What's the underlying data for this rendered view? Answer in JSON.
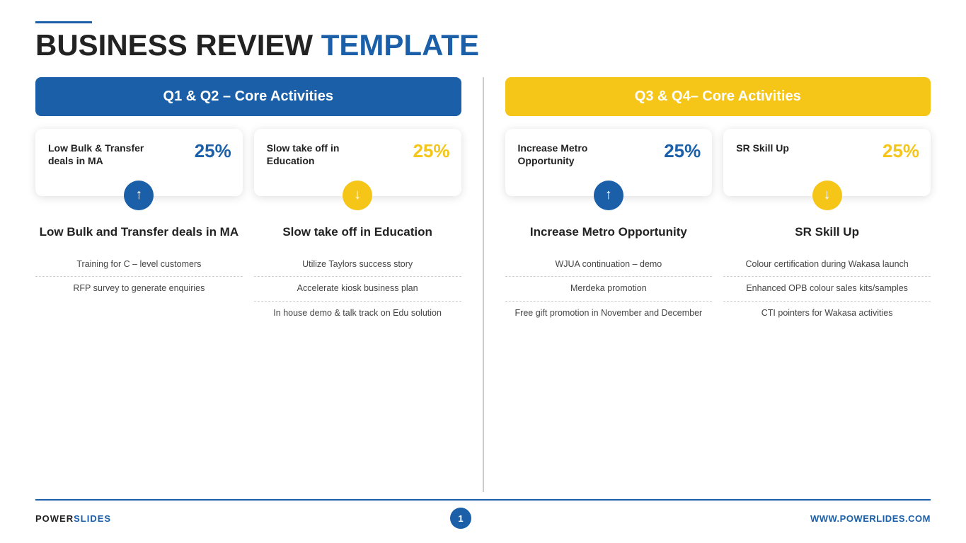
{
  "header": {
    "line": true,
    "title_black": "BUSINESS REVIEW",
    "title_blue": "TEMPLATE"
  },
  "left_section": {
    "header_label": "Q1 & Q2 – Core Activities",
    "cards": [
      {
        "title": "Low Bulk & Transfer deals in MA",
        "percent": "25%",
        "percent_color": "blue",
        "icon": "up",
        "icon_color": "blue"
      },
      {
        "title": "Slow take off in Education",
        "percent": "25%",
        "percent_color": "yellow",
        "icon": "down",
        "icon_color": "yellow"
      }
    ],
    "columns": [
      {
        "title": "Low Bulk and Transfer deals in MA",
        "items": [
          "Training for C – level customers",
          "RFP survey to generate enquiries"
        ]
      },
      {
        "title": "Slow take off in Education",
        "items": [
          "Utilize Taylors success story",
          "Accelerate kiosk business plan",
          "In house demo & talk track on Edu solution"
        ]
      }
    ]
  },
  "right_section": {
    "header_label": "Q3 & Q4– Core Activities",
    "cards": [
      {
        "title": "Increase Metro Opportunity",
        "percent": "25%",
        "percent_color": "blue",
        "icon": "up",
        "icon_color": "blue"
      },
      {
        "title": "SR Skill Up",
        "percent": "25%",
        "percent_color": "yellow",
        "icon": "down",
        "icon_color": "yellow"
      }
    ],
    "columns": [
      {
        "title": "Increase Metro Opportunity",
        "items": [
          "WJUA continuation – demo",
          "Merdeka promotion",
          "Free gift promotion in November and December"
        ]
      },
      {
        "title": "SR Skill Up",
        "items": [
          "Colour certification during Wakasa launch",
          "Enhanced OPB colour sales kits/samples",
          "CTI pointers for Wakasa activities"
        ]
      }
    ]
  },
  "footer": {
    "left_black": "POWER",
    "left_blue": "SLIDES",
    "page_number": "1",
    "right": "WWW.POWERLIDES.COM"
  }
}
